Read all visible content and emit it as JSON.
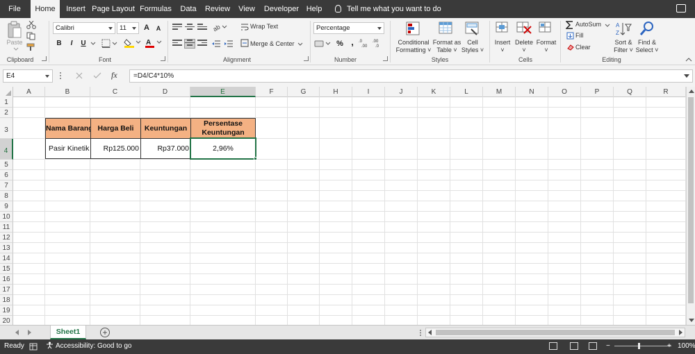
{
  "menu": {
    "tabs": [
      {
        "label": "File"
      },
      {
        "label": "Home"
      },
      {
        "label": "Insert"
      },
      {
        "label": "Page Layout"
      },
      {
        "label": "Formulas"
      },
      {
        "label": "Data"
      },
      {
        "label": "Review"
      },
      {
        "label": "View"
      },
      {
        "label": "Developer"
      },
      {
        "label": "Help"
      }
    ],
    "active_tab": "Home",
    "tell_me": "Tell me what you want to do"
  },
  "ribbon": {
    "clipboard": {
      "label": "Clipboard",
      "paste": "Paste"
    },
    "font": {
      "label": "Font",
      "name": "Calibri",
      "size": "11",
      "bold": "B",
      "italic": "I",
      "underline": "U",
      "grow": "A",
      "shrink": "A"
    },
    "alignment": {
      "label": "Alignment",
      "wrap_text": "Wrap Text",
      "merge_center": "Merge & Center"
    },
    "number": {
      "label": "Number",
      "format": "Percentage",
      "percent": "%",
      "comma": ","
    },
    "styles": {
      "label": "Styles",
      "conditional": "Conditional",
      "conditional2": "Formatting",
      "format_as": "Format as",
      "format_as2": "Table",
      "cell": "Cell",
      "cell2": "Styles"
    },
    "cells": {
      "label": "Cells",
      "insert": "Insert",
      "delete": "Delete",
      "format": "Format"
    },
    "editing": {
      "label": "Editing",
      "autosum": "AutoSum",
      "fill": "Fill",
      "clear": "Clear",
      "sort": "Sort &",
      "sort2": "Filter",
      "find": "Find &",
      "find2": "Select"
    }
  },
  "formula_bar": {
    "name_box": "E4",
    "fx": "fx",
    "formula": "=D4/C4*10%"
  },
  "grid": {
    "columns": [
      "A",
      "B",
      "C",
      "D",
      "E",
      "F",
      "G",
      "H",
      "I",
      "J",
      "K",
      "L",
      "M",
      "N",
      "O",
      "P",
      "Q",
      "R"
    ],
    "rows": [
      "1",
      "2",
      "3",
      "4",
      "5",
      "6",
      "7",
      "8",
      "9",
      "10",
      "11",
      "12",
      "13",
      "14",
      "15",
      "16",
      "17",
      "18",
      "19",
      "20"
    ],
    "selected_column": "E",
    "selected_row": "4",
    "table": {
      "headers": [
        "Nama Barang",
        "Harga Beli",
        "Keuntungan",
        "Persentase",
        "Keuntungan"
      ],
      "row": [
        "Pasir Kinetik",
        "Rp125.000",
        "Rp37.000",
        "2,96%"
      ]
    }
  },
  "sheets": {
    "tabs": [
      "Sheet1"
    ],
    "add": "+"
  },
  "status": {
    "ready": "Ready",
    "accessibility": "Accessibility: Good to go",
    "zoom": "100%",
    "minus": "−",
    "plus": "+"
  },
  "colors": {
    "accent": "#217346",
    "header_fill": "#f4b183",
    "chrome": "#3a3a3a"
  }
}
